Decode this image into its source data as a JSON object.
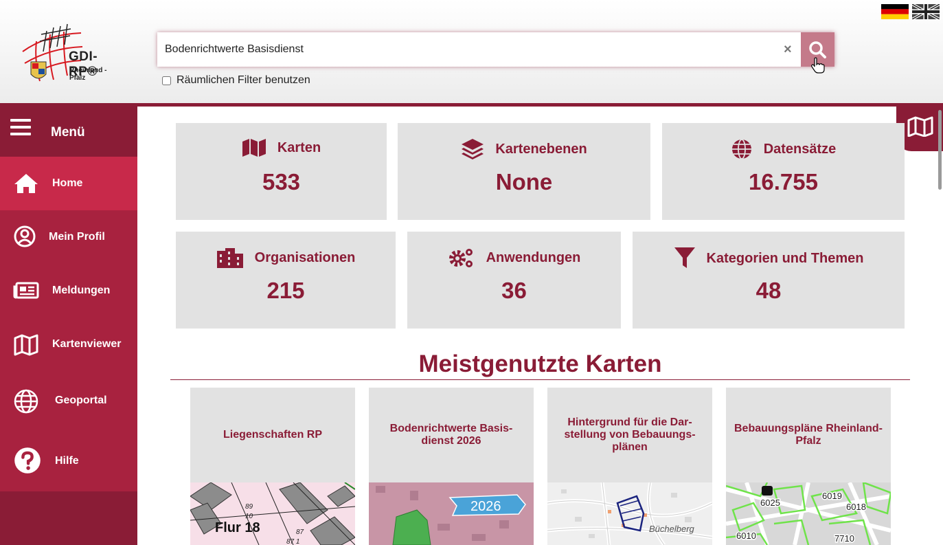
{
  "header": {
    "logo_text": "GDI-RP®",
    "logo_sub": "Rheinland - Pfalz",
    "search_value": "Bodenrichtwerte Basisdienst",
    "clear_symbol": "×",
    "filter_label": "Räumlichen Filter benutzen",
    "languages": [
      "de",
      "en"
    ]
  },
  "sidebar": {
    "menu_label": "Menü",
    "items": [
      {
        "label": "Home",
        "icon": "home-icon",
        "active": true
      },
      {
        "label": "Mein Profil",
        "icon": "user-circle-icon",
        "active": false
      },
      {
        "label": "Meldungen",
        "icon": "newspaper-icon",
        "active": false
      },
      {
        "label": "Kartenviewer",
        "icon": "map-icon",
        "active": false
      },
      {
        "label": "Geoportal",
        "icon": "globe-icon",
        "active": false
      },
      {
        "label": "Hilfe",
        "icon": "question-icon",
        "active": false
      }
    ]
  },
  "stats": [
    {
      "label": "Karten",
      "value": "533",
      "icon": "map-icon"
    },
    {
      "label": "Kartenebenen",
      "value": "None",
      "icon": "layers-icon"
    },
    {
      "label": "Datensätze",
      "value": "16.755",
      "icon": "globe-icon"
    },
    {
      "label": "Organisationen",
      "value": "215",
      "icon": "building-icon"
    },
    {
      "label": "Anwendungen",
      "value": "36",
      "icon": "gears-icon"
    },
    {
      "label": "Kategorien und Themen",
      "value": "48",
      "icon": "filter-icon"
    }
  ],
  "section_title": "Meistgenutzte Karten",
  "cards": [
    {
      "title": "Liegenschaften RP",
      "thumb_text": [
        "Flur 18",
        "89",
        "10",
        "87",
        "87 1"
      ]
    },
    {
      "title": "Bodenrichtwerte Basis-dienst 2026",
      "thumb_text": [
        "2026"
      ]
    },
    {
      "title": "Hintergrund für die Dar-stellung von Bebauungs-plänen",
      "thumb_text": [
        "Büchelberg"
      ]
    },
    {
      "title": "Bebauungspläne Rheinland-Pfalz",
      "thumb_text": [
        "6025",
        "6019",
        "6018",
        "6010",
        "7710"
      ]
    }
  ],
  "colors": {
    "brand": "#8a1c36",
    "nav": "#a8223f",
    "active": "#c8294a",
    "tile": "#e2e2e2"
  }
}
